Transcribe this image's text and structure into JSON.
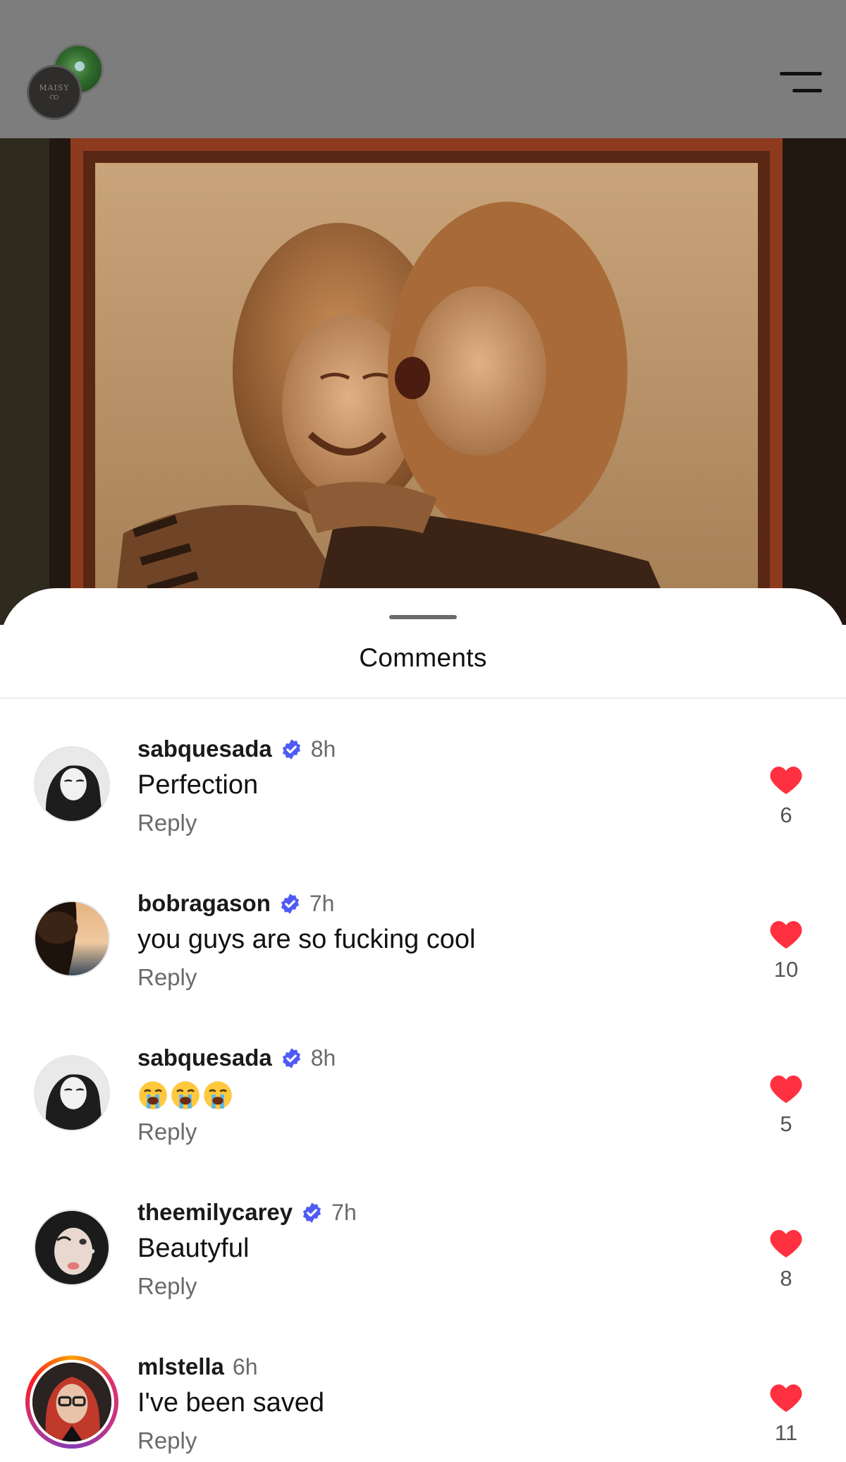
{
  "header": {
    "logo_text": [
      "MAISY",
      "…"
    ],
    "menu_icon": "hamburger-menu-icon"
  },
  "post": {
    "image_description_icon": "photo"
  },
  "sheet": {
    "title": "Comments"
  },
  "comments": [
    {
      "username": "sabquesada",
      "verified": true,
      "time": "8h",
      "text": "Perfection",
      "reply": "Reply",
      "likes": "6"
    },
    {
      "username": "bobragason",
      "verified": true,
      "time": "7h",
      "text": "you guys are so fucking cool",
      "reply": "Reply",
      "likes": "10"
    },
    {
      "username": "sabquesada",
      "verified": true,
      "time": "8h",
      "text": "😭😭😭",
      "reply": "Reply",
      "likes": "5"
    },
    {
      "username": "theemilycarey",
      "verified": true,
      "time": "7h",
      "text": "Beautyful",
      "reply": "Reply",
      "likes": "8"
    },
    {
      "username": "mlstella",
      "verified": false,
      "time": "6h",
      "text": "I've been saved",
      "reply": "Reply",
      "likes": "11"
    }
  ],
  "colors": {
    "like": "#ff3040",
    "verified": "#4f5bf5",
    "dim_overlay": "#7d7d7d"
  }
}
